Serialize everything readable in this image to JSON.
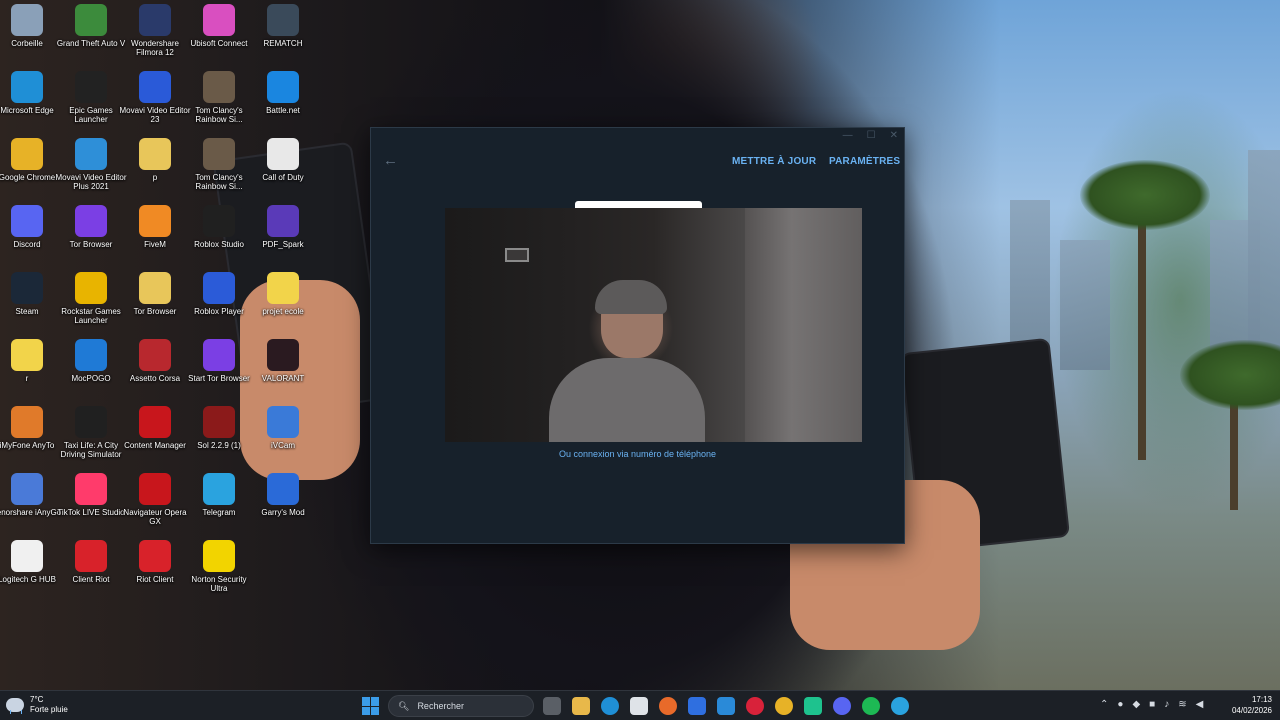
{
  "desktop": {
    "icons": [
      {
        "label": "Corbeille",
        "icon": "recycle-bin-icon"
      },
      {
        "label": "Grand Theft Auto V",
        "icon": "gta-v-icon"
      },
      {
        "label": "Wondershare Filmora 12",
        "icon": "filmora-icon"
      },
      {
        "label": "Ubisoft Connect",
        "icon": "ubisoft-icon"
      },
      {
        "label": "REMATCH",
        "icon": "rematch-icon"
      },
      {
        "label": "Microsoft Edge",
        "icon": "edge-icon"
      },
      {
        "label": "Epic Games Launcher",
        "icon": "epic-games-icon"
      },
      {
        "label": "Movavi Video Editor 23",
        "icon": "movavi-icon"
      },
      {
        "label": "Tom Clancy's Rainbow Si...",
        "icon": "rainbow-six-icon"
      },
      {
        "label": "Battle.net",
        "icon": "battlenet-icon"
      },
      {
        "label": "Google Chrome",
        "icon": "chrome-icon"
      },
      {
        "label": "Movavi Video Editor Plus 2021",
        "icon": "movavi-plus-icon"
      },
      {
        "label": "p",
        "icon": "folder-icon"
      },
      {
        "label": "Tom Clancy's Rainbow Si...",
        "icon": "rainbow-six-icon"
      },
      {
        "label": "Call of Duty",
        "icon": "file-icon"
      },
      {
        "label": "Discord",
        "icon": "discord-icon"
      },
      {
        "label": "Tor Browser",
        "icon": "tor-icon"
      },
      {
        "label": "FiveM",
        "icon": "fivem-icon"
      },
      {
        "label": "Roblox Studio",
        "icon": "roblox-studio-icon"
      },
      {
        "label": "PDF_Spark",
        "icon": "pdf-spark-icon"
      },
      {
        "label": "Steam",
        "icon": "steam-icon"
      },
      {
        "label": "Rockstar Games Launcher",
        "icon": "rockstar-icon"
      },
      {
        "label": "Tor Browser",
        "icon": "tor-folder-icon"
      },
      {
        "label": "Roblox Player",
        "icon": "roblox-player-icon"
      },
      {
        "label": "projet ecole",
        "icon": "folder-icon"
      },
      {
        "label": "r",
        "icon": "folder-icon"
      },
      {
        "label": "MocPOGO",
        "icon": "mocpogo-icon"
      },
      {
        "label": "Assetto Corsa",
        "icon": "assetto-icon"
      },
      {
        "label": "Start Tor Browser",
        "icon": "tor-icon"
      },
      {
        "label": "VALORANT",
        "icon": "valorant-icon"
      },
      {
        "label": "iMyFone AnyTo",
        "icon": "anyto-icon"
      },
      {
        "label": "Taxi Life: A City Driving Simulator",
        "icon": "taxi-icon"
      },
      {
        "label": "Content Manager",
        "icon": "content-manager-icon"
      },
      {
        "label": "Sol 2.2.9 (1)",
        "icon": "winrar-icon"
      },
      {
        "label": "iVCam",
        "icon": "ivcam-icon"
      },
      {
        "label": "Tenorshare iAnyGo",
        "icon": "ianygo-icon"
      },
      {
        "label": "TikTok LIVE Studio",
        "icon": "tiktok-icon"
      },
      {
        "label": "Navigateur Opera GX",
        "icon": "opera-gx-icon"
      },
      {
        "label": "Telegram",
        "icon": "telegram-icon"
      },
      {
        "label": "Garry's Mod",
        "icon": "gmod-icon"
      },
      {
        "label": "Logitech G HUB",
        "icon": "logitech-icon"
      },
      {
        "label": "Client Riot",
        "icon": "riot-icon"
      },
      {
        "label": "Riot Client",
        "icon": "riot-icon"
      },
      {
        "label": "Norton Security Ultra",
        "icon": "norton-icon"
      }
    ]
  },
  "app_window": {
    "back_icon": "back-arrow-icon",
    "update_label": "METTRE À JOUR",
    "settings_label": "PARAMÈTRES",
    "phone_login_label": "Ou connexion via numéro de téléphone"
  },
  "taskbar": {
    "weather_temp": "7°C",
    "weather_desc": "Forte pluie",
    "search_placeholder": "Rechercher",
    "time": "17:13",
    "date": "04/02/2026"
  },
  "colors": {
    "window_bg": "#17212b",
    "link_blue": "#6ab2f2",
    "taskbar_bg": "#1c2026"
  }
}
